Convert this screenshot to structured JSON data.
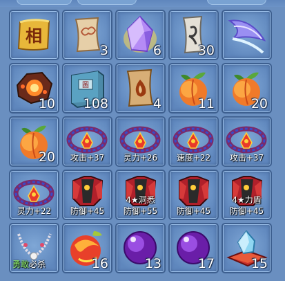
{
  "slots": [
    {
      "icon": "xiang-scroll-icon"
    },
    {
      "icon": "cloud-scroll-icon",
      "count": "3"
    },
    {
      "icon": "crystal-gem-icon",
      "count": "6"
    },
    {
      "icon": "rune-scroll-icon",
      "count": "30"
    },
    {
      "icon": "feather-wing-icon"
    },
    {
      "icon": "fire-rock-icon",
      "count": "10"
    },
    {
      "icon": "blue-book-icon",
      "count": "108"
    },
    {
      "icon": "flame-scroll-icon",
      "count": "4"
    },
    {
      "icon": "peach-icon",
      "count": "11"
    },
    {
      "icon": "peach-icon",
      "count": "20"
    },
    {
      "icon": "peach-icon",
      "count": "20"
    },
    {
      "icon": "crown-ring-icon",
      "stat": "攻击+37"
    },
    {
      "icon": "crown-ring-icon",
      "stat": "灵力+26"
    },
    {
      "icon": "crown-ring-icon",
      "stat": "速度+22"
    },
    {
      "icon": "crown-ring-icon",
      "stat": "攻击+37"
    },
    {
      "icon": "crown-ring-icon",
      "stat": "灵力+22"
    },
    {
      "icon": "red-armor-icon",
      "stat": "防御+45"
    },
    {
      "icon": "red-armor-icon",
      "subtitle": "4★洞悉",
      "stat": "防御+55"
    },
    {
      "icon": "red-armor-icon",
      "stat": "防御+45"
    },
    {
      "icon": "red-armor-icon",
      "subtitle": "4★力盾",
      "stat": "防御+45"
    },
    {
      "icon": "bead-necklace-icon",
      "badge_hl": "勇敢",
      "badge": "必杀"
    },
    {
      "icon": "fire-fruit-icon",
      "count": "16"
    },
    {
      "icon": "purple-orb-icon",
      "count": "13"
    },
    {
      "icon": "purple-orb-icon",
      "count": "17"
    },
    {
      "icon": "crystal-cushion-icon",
      "count": "15"
    }
  ],
  "colors": {
    "panel_bg": "#6a8fc0",
    "slot_border": "#3d5f8f",
    "count_text": "#ffffff",
    "badge_highlight": "#8ff06a"
  }
}
